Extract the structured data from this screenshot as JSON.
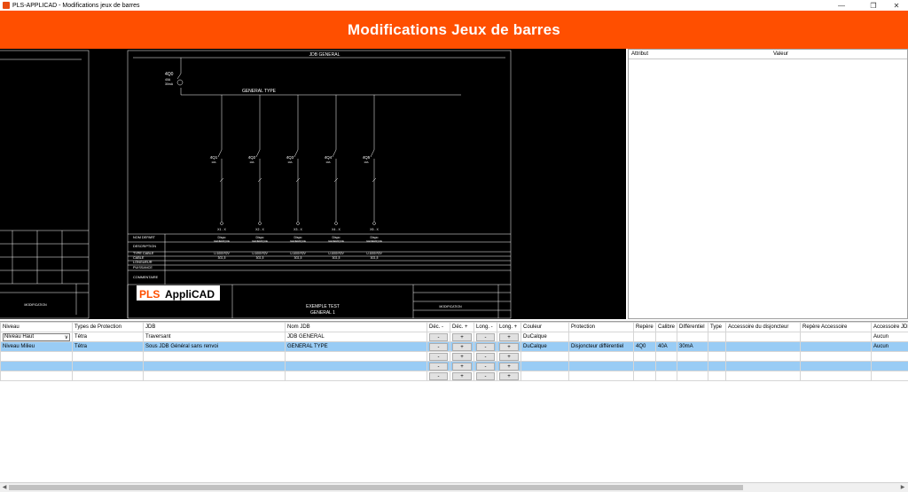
{
  "window": {
    "title": "PLS-APPLICAD - Modifications jeux de barres"
  },
  "banner": {
    "title": "Modifications Jeux de barres"
  },
  "drawing": {
    "busbar_title": "JDB GENERAL",
    "sub_busbar_label": "GENERAL TYPE",
    "incomer_label": "4Q0",
    "incomer_sub": "40A",
    "incomer_sub2": "30mA",
    "feeders": [
      {
        "label": "4Q1",
        "rating": "10A",
        "terminal": "X1 - X",
        "box": "Dispo\nGENERIQUE"
      },
      {
        "label": "4Q2",
        "rating": "10A",
        "terminal": "X2 - X",
        "box": "Dispo\nGENERIQUE"
      },
      {
        "label": "4Q3",
        "rating": "10A",
        "terminal": "X3 - X",
        "box": "Dispo\nGENERIQUE"
      },
      {
        "label": "4Q4",
        "rating": "10A",
        "terminal": "X4 - X",
        "box": "Dispo\nGENERIQUE"
      },
      {
        "label": "4Q5",
        "rating": "10A",
        "terminal": "X5 - X",
        "box": "Dispo\nGENERIQUE"
      }
    ],
    "row_labels": [
      "NOM DEPART",
      "DESCRIPTION",
      "TYPE CABLE",
      "CABLE",
      "LONGUEUR",
      "PUISSANCE",
      "COMMENTAIRE"
    ],
    "cable_type": "U-1000 R2V",
    "cable_value": "3G1,5",
    "logo_pls": "PLS",
    "logo_applicad": "AppliCAD",
    "project_title": "EXEMPLE TEST",
    "project_sub": "GENERAL 1",
    "cartouche_label": "MODIFICATION",
    "cartouche_label2": "MODIFICATION"
  },
  "attr_panel": {
    "col_attribut": "Attribut",
    "col_valeur": "Valeur"
  },
  "grid": {
    "headers": [
      "Niveau",
      "Types de Protection",
      "JDB",
      "Nom JDB",
      "Déc. -",
      "Déc. +",
      "Long. -",
      "Long. +",
      "Couleur",
      "Protection",
      "Repère",
      "Calibre",
      "Différentiel",
      "Type",
      "Accessoire du disjoncteur",
      "Repère Accessoire",
      "Accessoire JDB"
    ],
    "rows": [
      {
        "niveau": "Niveau Haut",
        "type_prot": "Tétra",
        "jdb": "Traversant",
        "nom_jdb": "JDB GENERAL",
        "couleur": "DuCalque",
        "protection": "",
        "repere": "",
        "calibre": "",
        "differentiel": "",
        "type": "",
        "acc_disj": "",
        "rep_acc": "",
        "acc_jdb": "Aucun"
      },
      {
        "niveau": "Niveau Milieu",
        "type_prot": "Tétra",
        "jdb": "Sous JDB Général sans renvoi",
        "nom_jdb": "GENERAL TYPE",
        "couleur": "DuCalque",
        "protection": "Disjoncteur différentiel",
        "repere": "4Q0",
        "calibre": "40A",
        "differentiel": "30mA",
        "type": "",
        "acc_disj": "",
        "rep_acc": "",
        "acc_jdb": "Aucun"
      }
    ],
    "btn_minus": "-",
    "btn_plus": "+",
    "combo_arrow": "∨"
  },
  "colors": {
    "accent": "#ff4f00",
    "selection": "#99ccf5"
  }
}
